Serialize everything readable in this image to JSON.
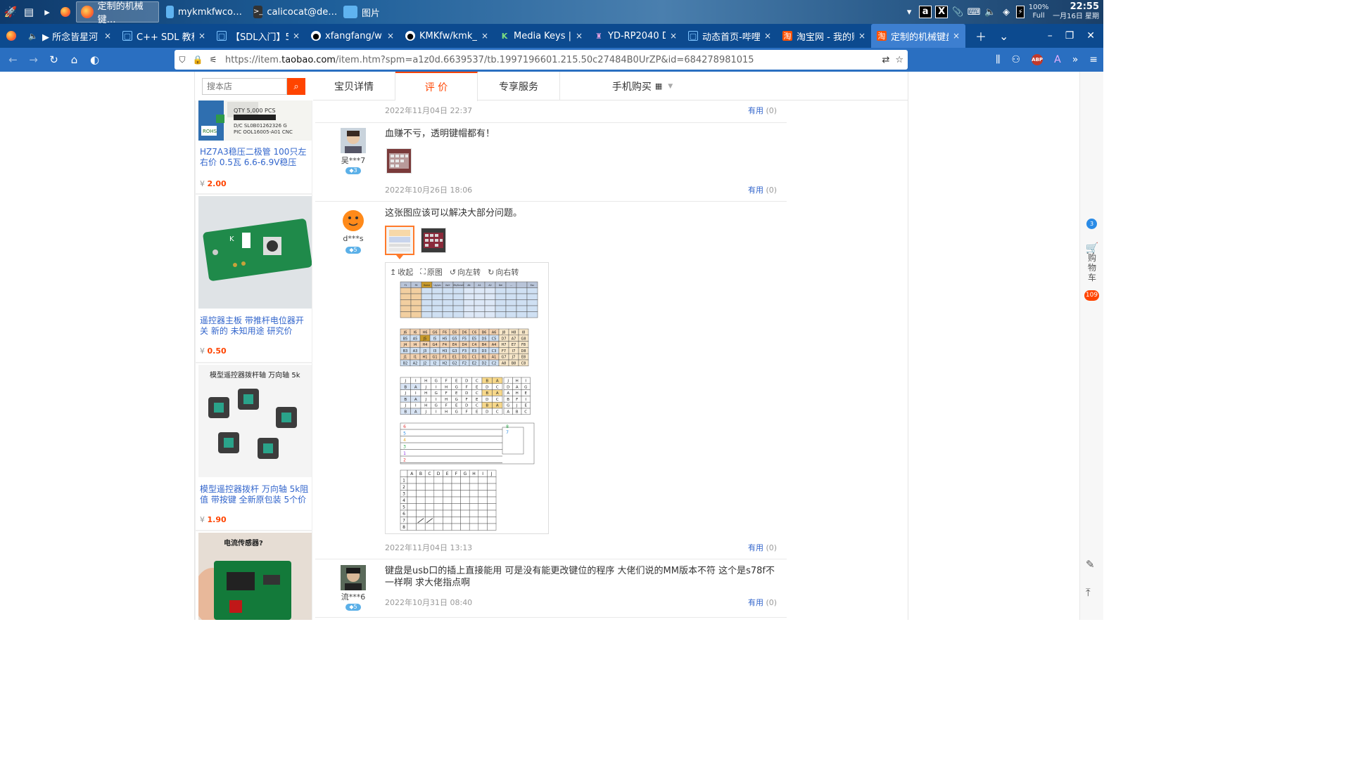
{
  "taskbar": {
    "tasks": [
      {
        "label": "定制的机械键…",
        "active": true
      },
      {
        "label": "mykmkfwco…",
        "active": false
      },
      {
        "label": "calicocat@de…",
        "active": false
      },
      {
        "label": "图片",
        "active": false
      }
    ],
    "tray": {
      "battery_percent": "100%",
      "battery_state": "Full",
      "time": "22:55",
      "date": "一月16日 星期"
    }
  },
  "browser": {
    "tabs": [
      {
        "label": "▶ 所念皆星河 - (",
        "icon": "speaker-icon"
      },
      {
        "label": "C++ SDL 教程#0",
        "icon": "bilibili-icon"
      },
      {
        "label": "【SDL入门】5 R",
        "icon": "bilibili-icon"
      },
      {
        "label": "xfangfang/wiliv",
        "icon": "github-icon"
      },
      {
        "label": "KMKfw/kmk_fir",
        "icon": "github-icon"
      },
      {
        "label": "Media Keys | KM",
        "icon": "kmk-icon"
      },
      {
        "label": "YD-RP2040 Dow",
        "icon": "page-icon"
      },
      {
        "label": "动态首页-哔哩哔",
        "icon": "bilibili-icon"
      },
      {
        "label": "淘宝网 - 我的购物",
        "icon": "taobao-icon"
      },
      {
        "label": "定制的机械键盘",
        "icon": "taobao-icon",
        "active": true
      }
    ],
    "url_prefix": "https://item.",
    "url_domain": "taobao.com",
    "url_suffix": "/item.htm?spm=a1z0d.6639537/tb.1997196601.215.50c27484B0UrZP&id=684278981015"
  },
  "shop": {
    "search_placeholder": "搜本店",
    "products": [
      {
        "title": "HZ7A3稳压二极管 100只左右价 0.5瓦 6.6-6.9V稳压",
        "currency": "¥",
        "price": "2.00"
      },
      {
        "title": "遥控器主板 带推杆电位器开关 新的 未知用途 研究价",
        "currency": "¥",
        "price": "0.50"
      },
      {
        "title": "模型遥控器拨杆 万向轴 5k阻值 带按键 全新原包装 5个价",
        "currency": "¥",
        "price": "1.90"
      },
      {
        "title": "",
        "currency": "",
        "price": ""
      }
    ],
    "product_image_texts": {
      "label_qty": "QTY 5,000 PCS",
      "label_dc": "D/C SL0B01262326 G",
      "label_pic": "PIC OOL16005-A01 CNC",
      "label_rohs": "ROHS",
      "stick_caption": "模型遥控器拨杆轴 万向轴 5k",
      "board4_caption": "电流传感器?"
    }
  },
  "detail_tabs": [
    {
      "label": "宝贝详情"
    },
    {
      "label": "评 价",
      "active": true
    },
    {
      "label": "专享服务"
    },
    {
      "label": "手机购买"
    }
  ],
  "reviews": {
    "useful_label": "有用",
    "useful_count": "(0)",
    "top_date": "2022年11月04日 22:37",
    "items": [
      {
        "user": "吴***7",
        "vip": "3",
        "text": "血赚不亏，透明键帽都有！",
        "date": "2022年10月26日 18:06"
      },
      {
        "user": "d***s",
        "vip": "5",
        "text": "这张图应该可以解决大部分问题。",
        "date": "2022年11月04日 13:13"
      },
      {
        "user": "流***6",
        "vip": "5",
        "text": "键盘是usb口的插上直接能用 可是没有能更改键位的程序 大佬们说的MM版本不符 这个是s78f不一样啊 求大佬指点啊",
        "date": "2022年10月31日 08:40"
      }
    ]
  },
  "viewer": {
    "tools": [
      "收起",
      "原图",
      "向左转",
      "向右转"
    ],
    "grid_a_header": [
      "F1",
      "F6",
      "Home",
      "Up/pin",
      "Vol+",
      "Ms/Scroll",
      "Alt",
      "A1",
      "A2",
      "Del",
      "…",
      "",
      "Esc"
    ],
    "grid_b_header": [
      "J6",
      "I6",
      "H6",
      "G6",
      "F6",
      "E6",
      "D6",
      "C6",
      "B6",
      "A6",
      "J8",
      "H8",
      "I8"
    ],
    "grid_b_rows": [
      [
        "B5",
        "A5",
        "J5",
        "I5",
        "H5",
        "G5",
        "F5",
        "E5",
        "D5",
        "C5",
        "D7",
        "A7",
        "G8"
      ],
      [
        "J4",
        "I4",
        "H4",
        "G4",
        "F4",
        "E4",
        "D4",
        "C4",
        "B4",
        "A4",
        "H7",
        "E7",
        "F8"
      ],
      [
        "B3",
        "A3",
        "J3",
        "I3",
        "H3",
        "G3",
        "F3",
        "E3",
        "D3",
        "C3",
        "F7",
        "I7",
        "D8"
      ],
      [
        "J1",
        "I1",
        "H1",
        "G1",
        "F1",
        "E1",
        "D1",
        "C1",
        "B1",
        "A1",
        "G7",
        "J7",
        "E8"
      ],
      [
        "B2",
        "A2",
        "J2",
        "I2",
        "H2",
        "G2",
        "F2",
        "E2",
        "D2",
        "C2",
        "A8",
        "B8",
        "C8"
      ]
    ],
    "grid_c_letters": [
      "J",
      "I",
      "H",
      "G",
      "F",
      "E",
      "D",
      "C",
      "B",
      "A"
    ],
    "grid_c_side": [
      [
        "J",
        "H",
        "I"
      ],
      [
        "D",
        "A",
        "G"
      ],
      [
        "A",
        "H",
        "E"
      ],
      [
        "B",
        "F",
        "I"
      ],
      [
        "G",
        "J",
        "E"
      ],
      [
        "A",
        "B",
        "C"
      ]
    ],
    "grid_d_numbers": [
      "6",
      "5",
      "4",
      "3",
      "1",
      "2"
    ],
    "grid_d_side": [
      "8",
      "7"
    ],
    "grid_e_cols": [
      "A",
      "B",
      "C",
      "D",
      "E",
      "F",
      "G",
      "H",
      "I",
      "J"
    ],
    "grid_e_rows": [
      "1",
      "2",
      "3",
      "4",
      "5",
      "6",
      "7",
      "8"
    ]
  },
  "floating": {
    "top_badge": "3",
    "cart_label": [
      "购",
      "物",
      "车"
    ],
    "cart_count": "109"
  },
  "colors": {
    "taobao_orange": "#ff4400",
    "link_blue": "#3366cc",
    "firefox_tab_bg": "#0c4a8f",
    "firefox_nav_bg": "#2a6fc1"
  }
}
